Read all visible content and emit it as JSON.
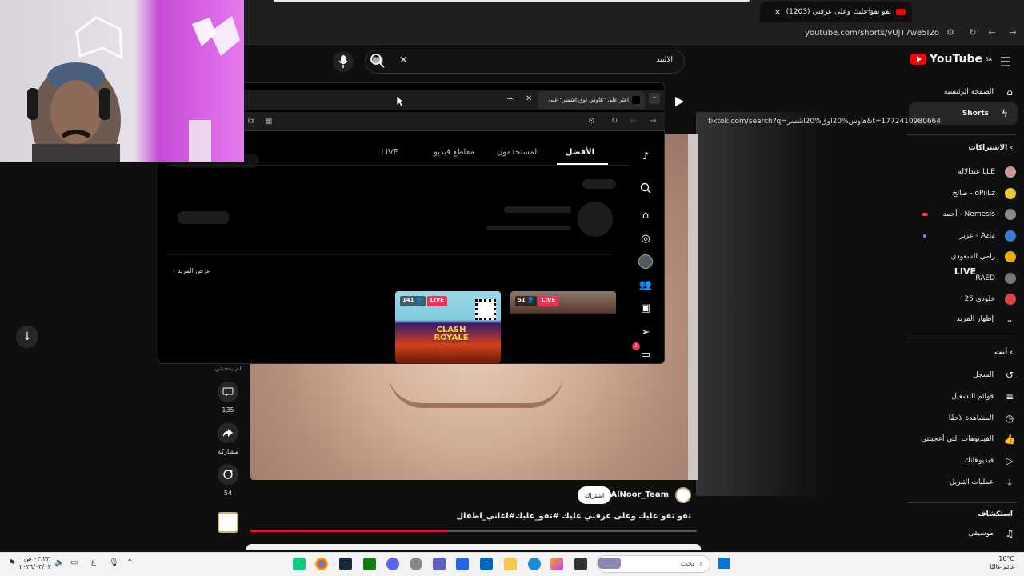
{
  "browser": {
    "tab_title": "(1203) تفو تفو عليك وعلى عرفني",
    "url": "youtube.com/shorts/vUjT7we5I2o"
  },
  "youtube": {
    "logo_text": "YouTube",
    "logo_region": "SA",
    "search_value": "الالتيد",
    "sidebar": {
      "home": "الصفحة الرئيسية",
      "shorts": "Shorts",
      "subscriptions_heading": "الاشتراكات",
      "subscriptions": [
        {
          "label": "عبدالاله LLE",
          "color": "#c99"
        },
        {
          "label": "صالح - oPiiLz",
          "color": "#e8c83a"
        },
        {
          "label": "أحمد - Nemesis",
          "color": "#8a8a8a",
          "live": true
        },
        {
          "label": "عزيز - Aziz",
          "color": "#3a7bd5",
          "new": true
        },
        {
          "label": "رامي السعودي",
          "color": "#e6b400"
        },
        {
          "label": "RAED",
          "color": "#777"
        },
        {
          "label": "خلودي 25",
          "color": "#d44"
        }
      ],
      "show_more": "إظهار المزيد",
      "you_heading": "أنت",
      "you_items": [
        {
          "label": "السجل",
          "icon": "history-icon"
        },
        {
          "label": "قوائم التشغيل",
          "icon": "playlist-icon"
        },
        {
          "label": "المشاهدة لاحقًا",
          "icon": "clock-icon"
        },
        {
          "label": "الفيديوهات التي أعجبتني",
          "icon": "thumb-up-icon"
        },
        {
          "label": "فيديوهاتك",
          "icon": "your-videos-icon"
        },
        {
          "label": "عمليات التنزيل",
          "icon": "download-icon"
        }
      ],
      "explore_heading": "استكشاف",
      "explore_items": [
        {
          "label": "موسيقى",
          "icon": "music-icon"
        }
      ]
    },
    "short": {
      "channel": "@AlNoor_Team",
      "subscribe_label": "اشتراك",
      "title": "تفو تفو عليك وعلى عرفني عليك #تفو_عليك#اغاني_اطفال",
      "partial_label": "لم يعجبني",
      "comments_count": "135",
      "share_label": "مشاركة",
      "remix_count": "54",
      "progress_fraction": 0.44
    }
  },
  "tiktok": {
    "tab_title": "اعثر على \"هاوس اوق اشسر\" على",
    "url": "tiktok.com/search?q=هاوس%20اوق%20اشسر&t=1772410980664",
    "tabs": [
      "الأفضل",
      "المستخدمون",
      "مقاطع فيديو",
      "LIVE"
    ],
    "live_heading": "LIVE",
    "see_more": "عرض المزيد",
    "live_cards": [
      {
        "viewers": "51",
        "live_label": "LIVE"
      },
      {
        "viewers": "141",
        "live_label": "LIVE",
        "game_text": "CLASH ROYALE"
      }
    ],
    "notification_count": "2"
  },
  "taskbar": {
    "time": "٠٣:٢٣ ص",
    "date": "٢٠٢٦/٠٣/٠٢",
    "search_placeholder": "بحث",
    "temperature": "16°C",
    "weather_label": "غائم غالبًا",
    "lang": "ع"
  },
  "colors": {
    "yt_red": "#ff0000",
    "tiktok_live": "#fe2c55",
    "progress": "#ff0033"
  }
}
